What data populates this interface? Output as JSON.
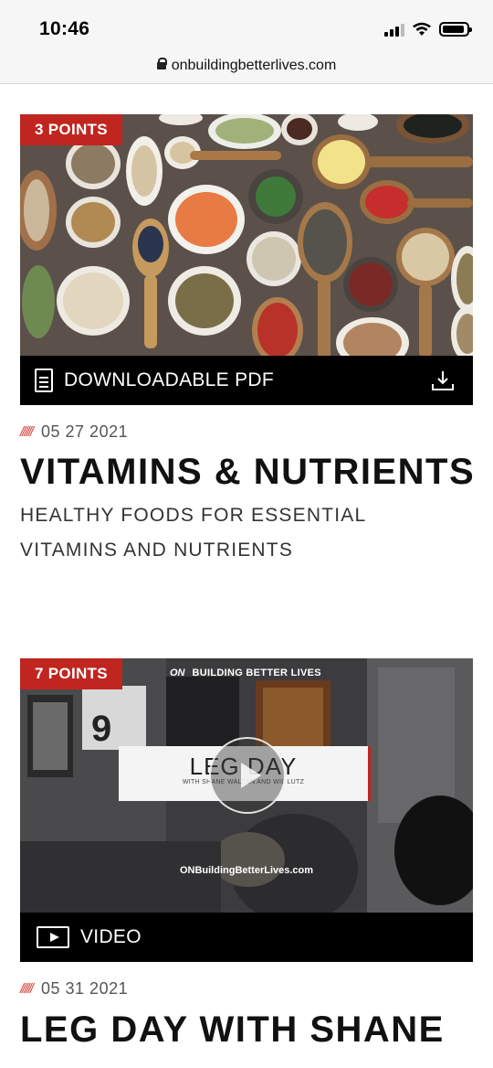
{
  "status_bar": {
    "time": "10:46"
  },
  "url_bar": {
    "url": "onbuildingbetterlives.com"
  },
  "cards": [
    {
      "points": "3 POINTS",
      "media_type": "DOWNLOADABLE PDF",
      "slashes": "//////",
      "date": "05 27 2021",
      "title": "VITAMINS & NUTRIENTS",
      "subtitle": "HEALTHY FOODS FOR ESSENTIAL VITAMINS AND NUTRIENTS"
    },
    {
      "points": "7 POINTS",
      "media_type": "VIDEO",
      "slashes": "//////",
      "date": "05 31 2021",
      "title": "LEG DAY WITH SHANE",
      "video_brand_logo": "ON",
      "video_brand": "BUILDING BETTER LIVES",
      "video_panel_title": "LEG DAY",
      "video_panel_subtitle": "WITH SHANE WALLEN AND WIL LUTZ",
      "video_site": "ONBuildingBetterLives.com"
    }
  ],
  "colors": {
    "accent": "#c0261f",
    "footer": "#000000"
  }
}
